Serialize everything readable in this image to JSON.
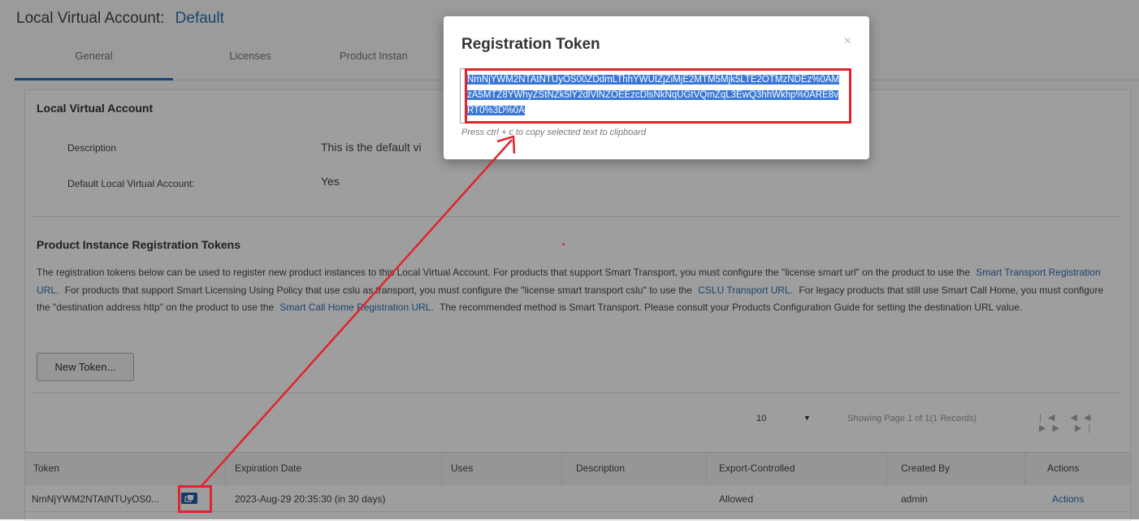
{
  "header": {
    "title": "Local Virtual Account:",
    "account": "Default"
  },
  "tabs": [
    {
      "label": "General",
      "active": true
    },
    {
      "label": "Licenses"
    },
    {
      "label": "Product Instan"
    }
  ],
  "section_account": {
    "title": "Local Virtual Account",
    "fields": [
      {
        "label": "Description",
        "value": "This is the default vi"
      },
      {
        "label": "Default Local Virtual Account:",
        "value": "Yes"
      }
    ]
  },
  "section_tokens": {
    "title": "Product Instance Registration Tokens",
    "text_1": "The registration tokens below can be used to register new product instances to this Local Virtual Account. For products that support Smart Transport, you must configure the \"license smart url\" on the product to use the",
    "link_1": "Smart Transport Registration URL.",
    "text_2": "For products that support Smart Licensing Using Policy that use cslu as transport, you must configure the \"license smart transport cslu\" to use the",
    "link_2": "CSLU Transport URL.",
    "text_3": "For legacy products that still use Smart Call Home, you must configure the \"destination address http\" on the product to use the",
    "link_3": "Smart Call Home Registration URL.",
    "text_4": "The recommended method is Smart Transport. Please consult your Products Configuration Guide for setting the destination URL value.",
    "new_token_button": "New Token..."
  },
  "pager": {
    "page_size": "10",
    "info": "Showing Page 1 of 1(1 Records)",
    "icons": "|◀ ◀◀ ▶▶ ▶|"
  },
  "table": {
    "columns": [
      "Token",
      "Expiration Date",
      "Uses",
      "Description",
      "Export-Controlled",
      "Created By",
      "Actions"
    ],
    "rows": [
      [
        "NmNjYWM2NTAtNTUyOS0...",
        "2023-Aug-29 20:35:30 (in 30 days)",
        "",
        "",
        "Allowed",
        "admin",
        "Actions"
      ]
    ]
  },
  "modal": {
    "title": "Registration Token",
    "close": "×",
    "token": "NmNjYWM2NTAtNTUyOS00ZDdmLThhYWUtZjZiMjE2MTM5Mjk5LTE2OTMzNDEz%0AMzA5MTZ8YWhyZStNZk5lY2dlVlNZOEEzcDlsNkNqUGtVQmZqL3EwQ3hhWkhp%0ARE8vRT0%3D%0A",
    "hint": "Press ctrl + c to copy selected text to clipboard"
  },
  "colors": {
    "accent": "#2a6fb4",
    "annotation": "#e0242d",
    "selection": "#3a78d8"
  }
}
